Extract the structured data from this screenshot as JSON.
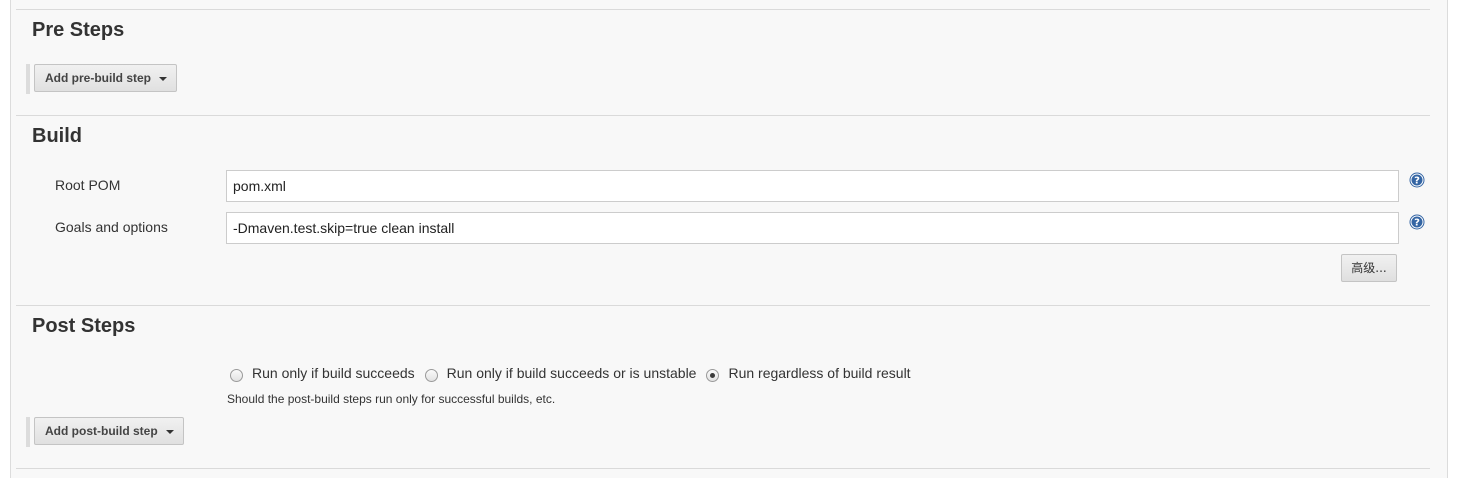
{
  "pre_steps": {
    "title": "Pre Steps",
    "add_button_label": "Add pre-build step"
  },
  "build": {
    "title": "Build",
    "root_pom": {
      "label": "Root POM",
      "value": "pom.xml"
    },
    "goals": {
      "label": "Goals and options",
      "value": "-Dmaven.test.skip=true clean install"
    },
    "advanced_label": "高级..."
  },
  "post_steps": {
    "title": "Post Steps",
    "options": [
      {
        "label": "Run only if build succeeds",
        "checked": false
      },
      {
        "label": "Run only if build succeeds or is unstable",
        "checked": false
      },
      {
        "label": "Run regardless of build result",
        "checked": true
      }
    ],
    "hint": "Should the post-build steps run only for successful builds, etc.",
    "add_button_label": "Add post-build step"
  },
  "colors": {
    "help_icon": "#3465a4",
    "panel_background": "#f8f8f8"
  },
  "icons": {
    "help": "help-icon",
    "dropdown": "caret-down-icon"
  }
}
